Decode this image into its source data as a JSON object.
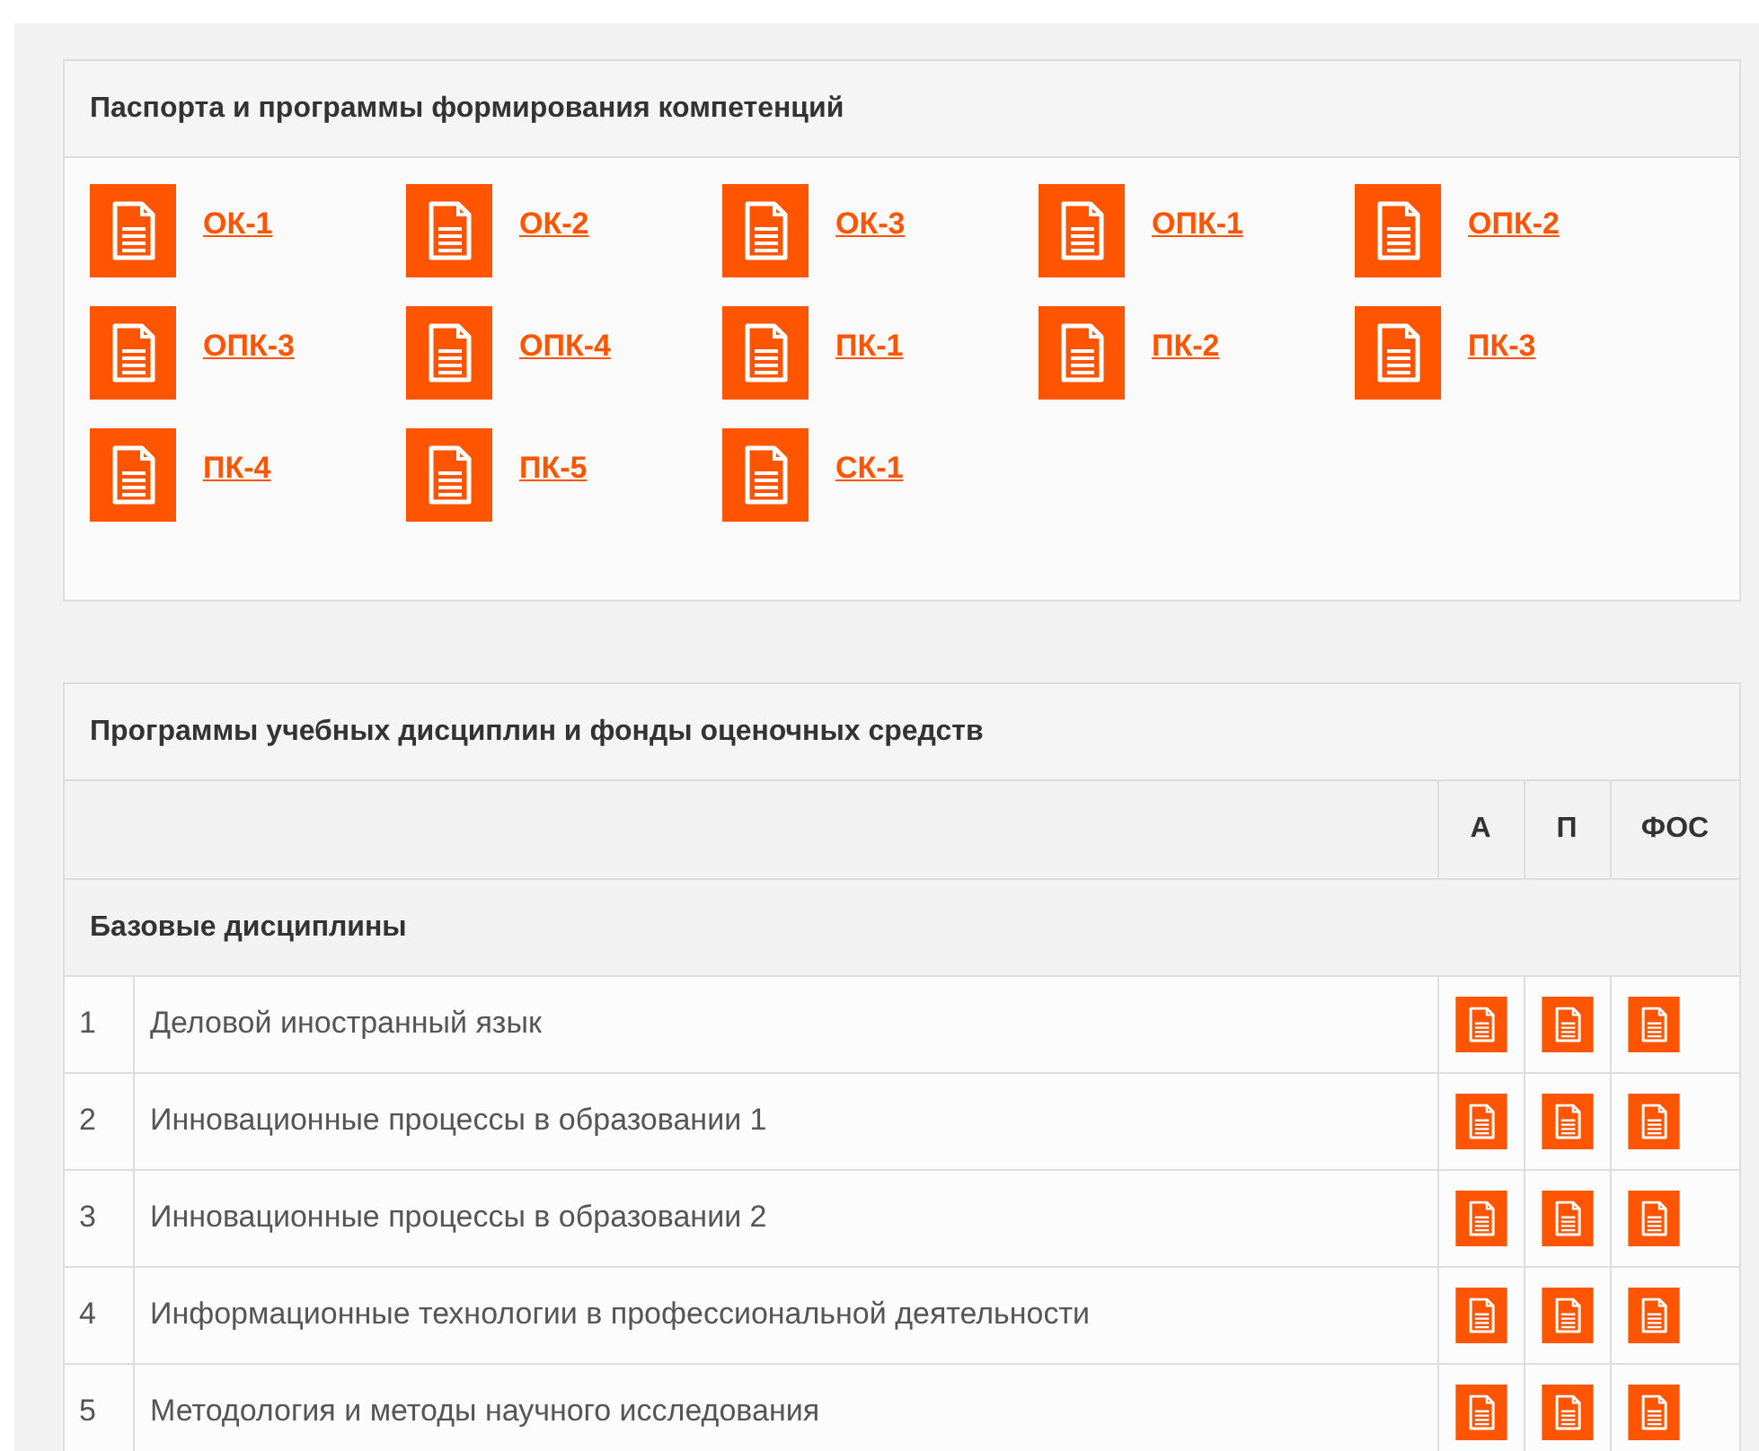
{
  "competencies": {
    "title": "Паспорта и программы формирования компетенций",
    "links": [
      "ОК-1",
      "ОК-2",
      "ОК-3",
      "ОПК-1",
      "ОПК-2",
      "ОПК-3",
      "ОПК-4",
      "ПК-1",
      "ПК-2",
      "ПК-3",
      "ПК-4",
      "ПК-5",
      "СК-1"
    ]
  },
  "disciplines": {
    "title": "Программы учебных дисциплин и фонды оценочных средств",
    "columns": [
      "А",
      "П",
      "ФОС"
    ],
    "section": "Базовые дисциплины",
    "rows": [
      {
        "number": "1",
        "name": "Деловой иностранный язык"
      },
      {
        "number": "2",
        "name": "Инновационные процессы в образовании 1"
      },
      {
        "number": "3",
        "name": "Инновационные процессы в образовании 2"
      },
      {
        "number": "4",
        "name": "Информационные технологии в профессиональной деятельности"
      },
      {
        "number": "5",
        "name": "Методология и методы научного исследования"
      }
    ]
  }
}
